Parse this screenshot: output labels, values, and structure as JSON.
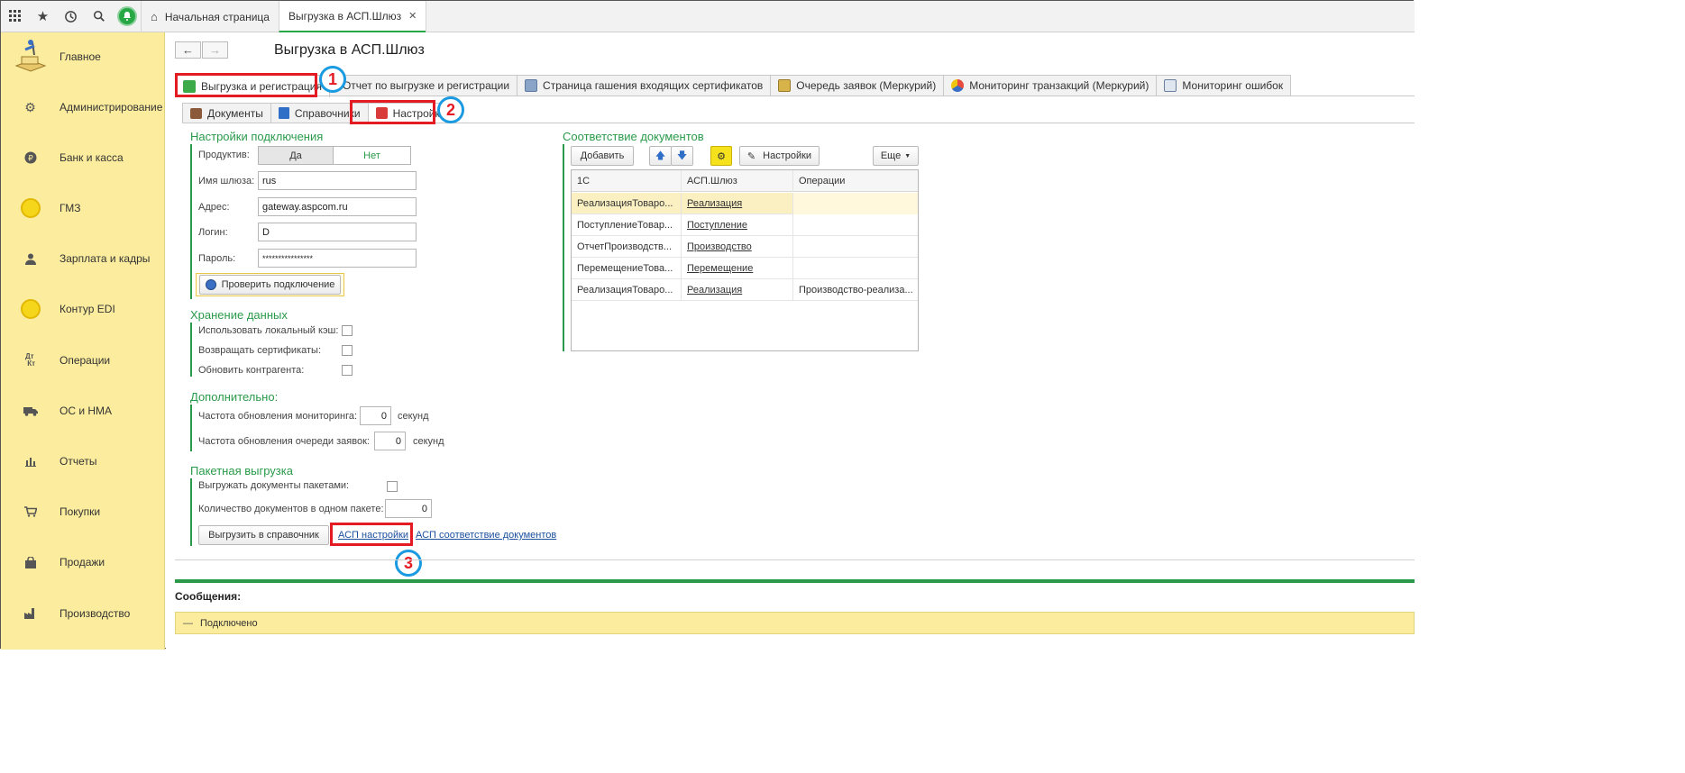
{
  "topbar": {
    "tabs": [
      {
        "label": "Начальная страница"
      },
      {
        "label": "Выгрузка в АСП.Шлюз"
      }
    ]
  },
  "sidebar": {
    "items": [
      {
        "label": "Главное",
        "icon": "logo-icon"
      },
      {
        "label": "Администрирование",
        "icon": "gear-icon"
      },
      {
        "label": "Банк и касса",
        "icon": "ruble-icon"
      },
      {
        "label": "ГМЗ",
        "icon": "coin-icon"
      },
      {
        "label": "Зарплата и кадры",
        "icon": "person-icon"
      },
      {
        "label": "Контур EDI",
        "icon": "coin-icon"
      },
      {
        "label": "Операции",
        "icon": "dt-kt-icon"
      },
      {
        "label": "ОС и НМА",
        "icon": "truck-icon"
      },
      {
        "label": "Отчеты",
        "icon": "bar-chart-icon"
      },
      {
        "label": "Покупки",
        "icon": "cart-icon"
      },
      {
        "label": "Продажи",
        "icon": "bag-icon"
      },
      {
        "label": "Производство",
        "icon": "factory-icon"
      }
    ]
  },
  "main": {
    "title": "Выгрузка в АСП.Шлюз",
    "tabs": [
      {
        "label": "Выгрузка и регистрация"
      },
      {
        "label": "Отчет по выгрузке и регистрации"
      },
      {
        "label": "Страница гашения входящих сертификатов"
      },
      {
        "label": "Очередь заявок (Меркурий)"
      },
      {
        "label": "Мониторинг транзакций (Меркурий)"
      },
      {
        "label": "Мониторинг ошибок"
      }
    ],
    "subtabs": [
      {
        "label": "Документы"
      },
      {
        "label": "Справочники"
      },
      {
        "label": "Настройки"
      }
    ],
    "markers": [
      "1",
      "2",
      "3"
    ]
  },
  "connection": {
    "title": "Настройки подключения",
    "productive_label": "Продуктив:",
    "yes": "Да",
    "no": "Нет",
    "gateway_label": "Имя шлюза:",
    "gateway_value": "rus",
    "address_label": "Адрес:",
    "address_value": "gateway.aspcom.ru",
    "login_label": "Логин:",
    "login_value": "D",
    "password_label": "Пароль:",
    "password_value": "****************",
    "check_button": "Проверить подключение"
  },
  "storage": {
    "title": "Хранение данных",
    "local_cache": "Использовать локальный кэш:",
    "return_certs": "Возвращать сертификаты:",
    "update_counterparty": "Обновить контрагента:"
  },
  "additional": {
    "title": "Дополнительно:",
    "monitoring_freq": "Частота обновления мониторинга:",
    "monitoring_value": "0",
    "queue_freq": "Частота обновления очереди заявок:",
    "queue_value": "0",
    "unit": "секунд"
  },
  "batch": {
    "title": "Пакетная выгрузка",
    "upload_batches": "Выгружать документы пакетами:",
    "docs_per_batch": "Количество документов в одном пакете:",
    "docs_per_batch_value": "0",
    "upload_button": "Выгрузить в справочник",
    "link_settings": "АСП настройки",
    "link_mapping": "АСП соответствие документов"
  },
  "mapping": {
    "title": "Соответствие документов",
    "add_button": "Добавить",
    "settings_button": "Настройки",
    "more_button": "Еще",
    "columns": [
      "1С",
      "АСП.Шлюз",
      "Операции"
    ],
    "rows": [
      {
        "c1": "РеализацияТоваро...",
        "c2": "Реализация",
        "c3": ""
      },
      {
        "c1": "ПоступлениеТовар...",
        "c2": "Поступление",
        "c3": ""
      },
      {
        "c1": "ОтчетПроизводств...",
        "c2": "Производство",
        "c3": ""
      },
      {
        "c1": "ПеремещениеТова...",
        "c2": "Перемещение",
        "c3": ""
      },
      {
        "c1": "РеализацияТоваро...",
        "c2": "Реализация",
        "c3": "Производство-реализа..."
      }
    ]
  },
  "messages": {
    "title": "Сообщения:",
    "text": "Подключено"
  },
  "colors": {
    "accent_green": "#2a9a4a",
    "sidebar_yellow": "#fbec9e",
    "highlight_red": "#e41b23",
    "circle_blue": "#1a9ae0"
  }
}
